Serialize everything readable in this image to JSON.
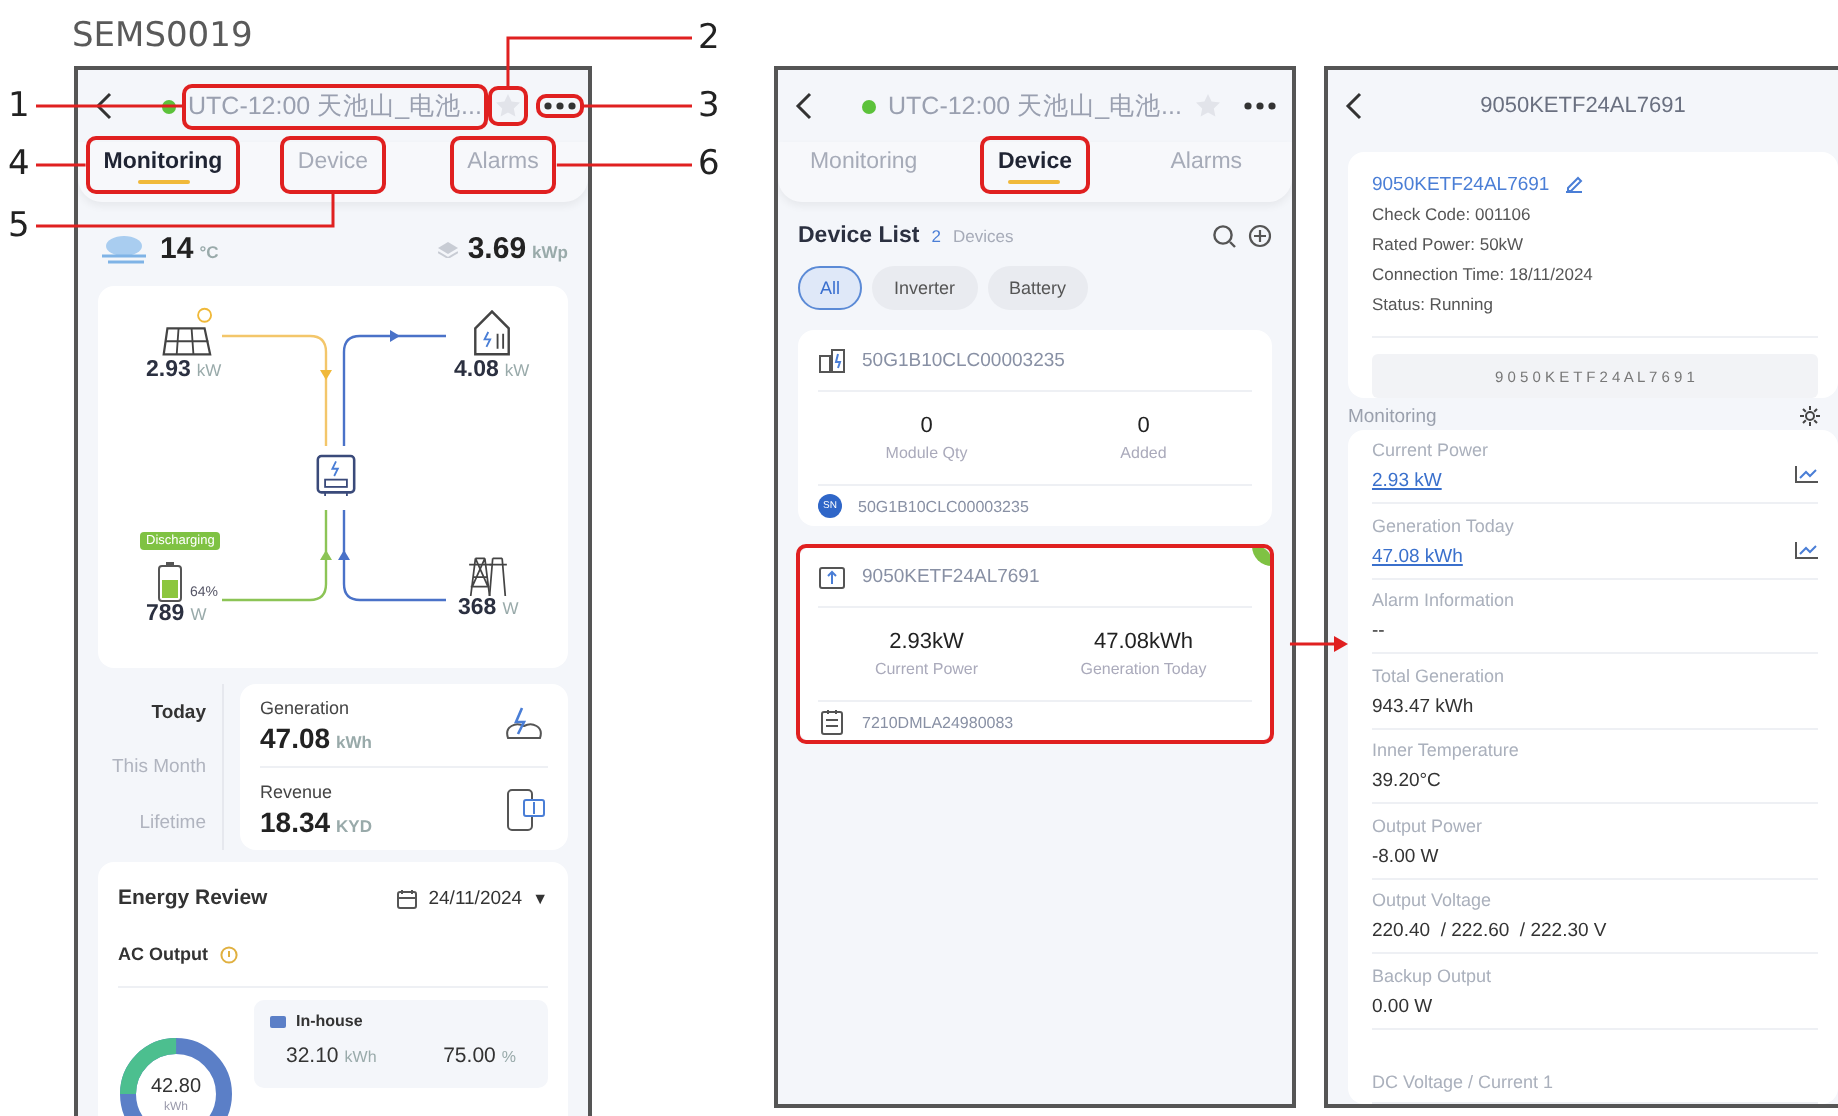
{
  "caption": "SEMS0019",
  "screens": [
    {
      "kind": "plant",
      "header": {
        "online": true,
        "title": "UTC-12:00 天池山_电池...",
        "title_callout": {
          "number": "1"
        },
        "favorite": false,
        "favorite_callout": {
          "number": "2"
        },
        "more_callout": {
          "number": "3"
        }
      },
      "tabs": [
        {
          "label": "Monitoring",
          "selected": true,
          "callout": {
            "number": "4"
          }
        },
        {
          "label": "Device",
          "selected": false,
          "callout": {
            "number": "5"
          }
        },
        {
          "label": "Alarms",
          "selected": false,
          "callout": {
            "number": "6"
          }
        }
      ],
      "weather": {
        "temperature": "14",
        "temp_unit": "°C",
        "capacity": "3.69",
        "capacity_unit": "kWp"
      },
      "flow": {
        "pv": {
          "value": "2.93",
          "unit": "kW"
        },
        "load": {
          "value": "4.08",
          "unit": "kW"
        },
        "battery": {
          "status": "Discharging",
          "soc": "64%",
          "level": 0.64,
          "value": "789",
          "unit": "W"
        },
        "grid": {
          "value": "368",
          "unit": "W"
        }
      },
      "periods": [
        {
          "label": "Today",
          "selected": true
        },
        {
          "label": "This Month",
          "selected": false
        },
        {
          "label": "Lifetime",
          "selected": false
        }
      ],
      "stats": [
        {
          "kind": "generation",
          "label": "Generation",
          "value": "47.08",
          "unit": "kWh"
        },
        {
          "kind": "revenue",
          "label": "Revenue",
          "value": "18.34",
          "unit": "KYD"
        }
      ],
      "energy_review": {
        "title": "Energy Review",
        "date": "24/11/2024",
        "date_caret": "▼",
        "metric": "AC Output",
        "total": "42.80",
        "total_unit": "kWh",
        "legend": [
          {
            "name": "In-house",
            "color": "#5b7fc7",
            "value": "32.10",
            "unit": "kWh",
            "percent": "75.00",
            "percent_unit": "%"
          }
        ]
      }
    },
    {
      "kind": "devices",
      "header": {
        "online": true,
        "title": "UTC-12:00 天池山_电池...",
        "favorite": false
      },
      "tabs": [
        {
          "label": "Monitoring",
          "selected": false
        },
        {
          "label": "Device",
          "selected": true,
          "highlighted": true
        },
        {
          "label": "Alarms",
          "selected": false
        }
      ],
      "device_list": {
        "title": "Device List",
        "count": "2",
        "count_label": "Devices"
      },
      "filters": [
        {
          "label": "All",
          "selected": true
        },
        {
          "label": "Inverter",
          "selected": false
        },
        {
          "label": "Battery",
          "selected": false
        }
      ],
      "devices": [
        {
          "kind": "battery",
          "name": "50G1B10CLC00003235",
          "online": false,
          "highlighted": false,
          "metrics": [
            {
              "value": "0",
              "label": "Module Qty"
            },
            {
              "value": "0",
              "label": "Added"
            }
          ],
          "footer": {
            "kind": "sn",
            "badge": "SN",
            "text": "50G1B10CLC00003235"
          }
        },
        {
          "kind": "inverter",
          "name": "9050KETF24AL7691",
          "online": true,
          "highlighted": true,
          "metrics": [
            {
              "value": "2.93kW",
              "label": "Current Power"
            },
            {
              "value": "47.08kWh",
              "label": "Generation Today"
            }
          ],
          "footer": {
            "kind": "module",
            "text": "7210DMLA24980083"
          }
        }
      ]
    },
    {
      "kind": "device_detail",
      "title": "9050KETF24AL7691",
      "info": {
        "serial": "9050KETF24AL7691",
        "lines": [
          "Check Code: 001106",
          "Rated Power: 50kW",
          "Connection Time: 18/11/2024",
          "Status: Running"
        ],
        "barcode": "9 0 5 0 K E T F 2 4 A L 7 6 9 1"
      },
      "section": "Monitoring",
      "readings": [
        {
          "label": "Current Power",
          "value": "2.93 kW",
          "kind": "link"
        },
        {
          "label": "Generation Today",
          "value": "47.08 kWh",
          "kind": "link"
        },
        {
          "label": "Alarm Information",
          "value": "--",
          "kind": "text"
        },
        {
          "label": "Total Generation",
          "value": "943.47 kWh",
          "kind": "text"
        },
        {
          "label": "Inner Temperature",
          "value": "39.20°C",
          "kind": "text"
        },
        {
          "label": "Output Power",
          "value": "-8.00 W",
          "kind": "text"
        },
        {
          "label": "Output Voltage",
          "value": "220.40  / 222.60  / 222.30 V",
          "kind": "text"
        },
        {
          "label": "Backup Output",
          "value": "0.00 W",
          "kind": "text"
        },
        {
          "label": "DC Voltage / Current 1",
          "kind": "label_only"
        }
      ]
    }
  ],
  "detail_arrow": true
}
